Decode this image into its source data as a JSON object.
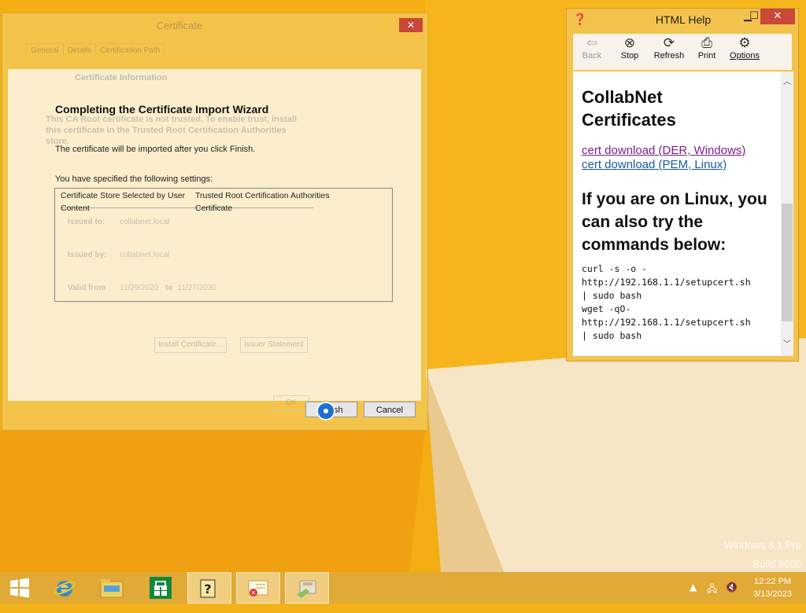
{
  "desktop": {
    "watermark_line1": "Windows 8.1 Pro",
    "watermark_line2": "Build 9600"
  },
  "certificate_dialog": {
    "title": "Certificate",
    "close_glyph": "✕",
    "tabs": [
      "General",
      "Details",
      "Certification Path"
    ],
    "info_title": "Certificate Information",
    "info_body": "This CA Root certificate is not trusted. To enable trust, install this certificate in the Trusted Root Certification Authorities store.",
    "issued_to_label": "Issued to:",
    "issued_to_value": "collabnet.local",
    "issued_by_label": "Issued by:",
    "issued_by_value": "collabnet.local",
    "valid_from_label": "Valid from",
    "valid_from_value": "11/29/2020",
    "valid_to_label": "to",
    "valid_to_value": "11/27/2030",
    "install_button": "Install Certificate...",
    "issuer_button": "Issuer Statement",
    "ok_button": "OK"
  },
  "wizard": {
    "heading": "Completing the Certificate Import Wizard",
    "subtitle": "The certificate will be imported after you click Finish.",
    "settings_label": "You have specified the following settings:",
    "settings": [
      {
        "key": "Certificate Store Selected by User",
        "value": "Trusted Root Certification Authorities"
      },
      {
        "key": "Content",
        "value": "Certificate"
      }
    ],
    "finish_button": "Finish",
    "cancel_button": "Cancel"
  },
  "help_window": {
    "title": "HTML Help",
    "minimize_glyph": "▁",
    "maximize_glyph": "☐",
    "close_glyph": "✕",
    "toolbar": [
      {
        "label": "Back",
        "icon": "back-arrow-icon",
        "glyph": "⇦",
        "enabled": false
      },
      {
        "label": "Stop",
        "icon": "stop-icon",
        "glyph": "⊗",
        "enabled": true
      },
      {
        "label": "Refresh",
        "icon": "refresh-icon",
        "glyph": "⟳",
        "enabled": true
      },
      {
        "label": "Print",
        "icon": "printer-icon",
        "glyph": "⎙",
        "enabled": true
      },
      {
        "label": "Options",
        "icon": "options-icon",
        "glyph": "⚙",
        "enabled": true
      }
    ],
    "heading": "CollabNet Certificates",
    "link_der": "cert download (DER, Windows)",
    "link_pem": "cert download (PEM, Linux)",
    "linux_heading": "If you are on Linux, you can also try the commands below:",
    "code": "curl -s -o -\nhttp://192.168.1.1/setupcert.sh\n| sudo bash\nwget -qO-\nhttp://192.168.1.1/setupcert.sh\n| sudo bash",
    "link_visited_color": "#7a1f8a",
    "link_color": "#1a5aa8"
  },
  "taskbar": {
    "apps": [
      {
        "name": "start-button",
        "icon": "windows-logo-icon"
      },
      {
        "name": "internet-explorer",
        "icon": "ie-icon"
      },
      {
        "name": "file-explorer",
        "icon": "folder-icon"
      },
      {
        "name": "store",
        "icon": "store-icon"
      },
      {
        "name": "html-help",
        "icon": "help-icon"
      },
      {
        "name": "certificate",
        "icon": "certificate-icon"
      },
      {
        "name": "import-wizard",
        "icon": "wizard-icon"
      }
    ],
    "time": "12:22 PM",
    "date": "3/13/2023"
  }
}
